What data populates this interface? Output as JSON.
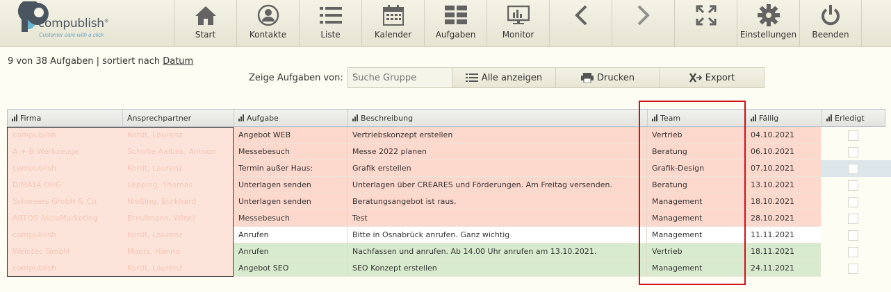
{
  "app": {
    "name": "compublish",
    "tagline": "Customer care with a click"
  },
  "colors": {
    "overdue": "#fdd8cc",
    "normal": "#ffffff",
    "done": "#d9ebcf",
    "highlight": "#d0101a"
  },
  "toolbar": [
    {
      "id": "start",
      "label": "Start",
      "icon": "home-icon"
    },
    {
      "id": "kontakte",
      "label": "Kontakte",
      "icon": "contacts-icon"
    },
    {
      "id": "liste",
      "label": "Liste",
      "icon": "list-icon"
    },
    {
      "id": "kalender",
      "label": "Kalender",
      "icon": "calendar-icon"
    },
    {
      "id": "aufgaben",
      "label": "Aufgaben",
      "icon": "tasks-icon"
    },
    {
      "id": "monitor",
      "label": "Monitor",
      "icon": "monitor-icon"
    },
    {
      "id": "back",
      "label": "",
      "icon": "chevron-left-icon"
    },
    {
      "id": "forward",
      "label": "",
      "icon": "chevron-right-icon"
    },
    {
      "id": "fullscreen",
      "label": "",
      "icon": "fullscreen-icon"
    },
    {
      "id": "einstellungen",
      "label": "Einstellungen",
      "icon": "gear-icon"
    },
    {
      "id": "beenden",
      "label": "Beenden",
      "icon": "power-icon"
    }
  ],
  "summary": {
    "text": "9 von 38 Aufgaben | sortiert nach ",
    "sort_field": "Datum"
  },
  "filter": {
    "label": "Zeige Aufgaben von:",
    "search_placeholder": "Suche Gruppe",
    "show_all": "Alle anzeigen",
    "print": "Drucken",
    "export": "Export"
  },
  "table": {
    "columns": [
      "Firma",
      "Ansprechpartner",
      "Aufgabe",
      "Beschreibung",
      "Team",
      "Fällig",
      "Erledigt"
    ],
    "rows": [
      {
        "firma": "compublish",
        "partner": "Kordt, Laurenz",
        "aufgabe": "Angebot WEB",
        "beschreibung": "Vertriebskonzept erstellen",
        "team": "Vertrieb",
        "faellig": "04.10.2021",
        "status": "overdue"
      },
      {
        "firma": "A + B Werkzeuge",
        "partner": "Scholte-Aalbes, Antoon",
        "aufgabe": "Messebesuch",
        "beschreibung": "Messe 2022 planen",
        "team": "Beratung",
        "faellig": "06.10.2021",
        "status": "overdue"
      },
      {
        "firma": "compublish",
        "partner": "Kordt, Laurenz",
        "aufgabe": "Termin außer Haus:",
        "beschreibung": "Grafik erstellen",
        "team": "Grafik-Design",
        "faellig": "07.10.2021",
        "status": "overdue"
      },
      {
        "firma": "DIMATA OHG",
        "partner": "Lepping, Thomas",
        "aufgabe": "Unterlagen senden",
        "beschreibung": "Unterlagen über CREARES und Förderungen. Am Freitag versenden.",
        "team": "Beratung",
        "faellig": "13.10.2021",
        "status": "overdue"
      },
      {
        "firma": "Schweers GmbH & Co.",
        "partner": "Nießing, Burkhard",
        "aufgabe": "Unterlagen senden",
        "beschreibung": "Beratungsangebot ist raus.",
        "team": "Management",
        "faellig": "18.10.2021",
        "status": "overdue"
      },
      {
        "firma": "ARTOS AktivMarketing",
        "partner": "Breulmann, Winni",
        "aufgabe": "Messebesuch",
        "beschreibung": "Test",
        "team": "Management",
        "faellig": "28.10.2021",
        "status": "overdue"
      },
      {
        "firma": "compublish",
        "partner": "Kordt, Laurenz",
        "aufgabe": "Anrufen",
        "beschreibung": "Bitte in Osnabrück anrufen. Ganz wichtig",
        "team": "Management",
        "faellig": "11.11.2021",
        "status": "normal"
      },
      {
        "firma": "Welotec GmbH",
        "partner": "Moers, Hanno",
        "aufgabe": "Anrufen",
        "beschreibung": "Nachfassen und anrufen. Ab 14.00 Uhr anrufen am 13.10.2021.",
        "team": "Vertrieb",
        "faellig": "18.11.2021",
        "status": "done"
      },
      {
        "firma": "compublish",
        "partner": "Kordt, Laurenz",
        "aufgabe": "Angebot SEO",
        "beschreibung": "SEO Konzept erstellen",
        "team": "Management",
        "faellig": "24.11.2021",
        "status": "done"
      }
    ]
  }
}
